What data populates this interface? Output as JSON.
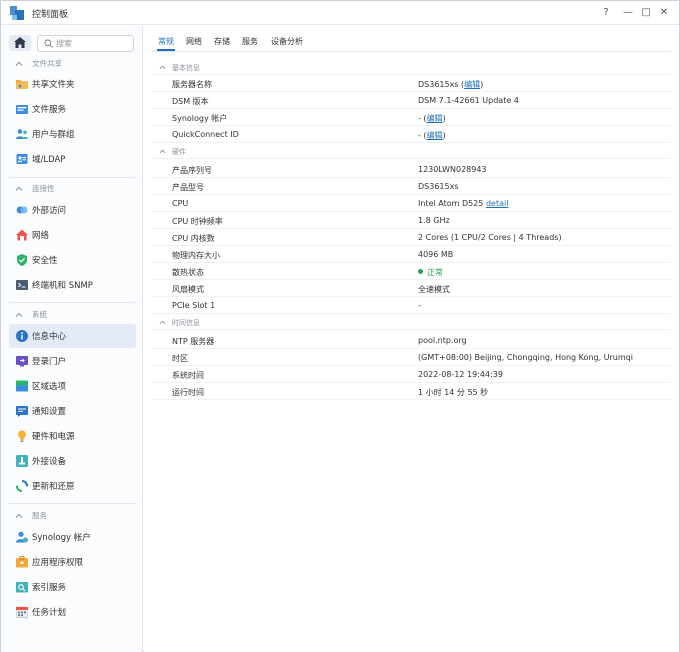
{
  "window": {
    "title": "控制面板",
    "help": "?",
    "minimize": "—",
    "maximize": "□",
    "close": "✕"
  },
  "sidebar": {
    "search_placeholder": "搜索",
    "sections": [
      {
        "title": "文件共享",
        "items": [
          {
            "label": "共享文件夹",
            "icon": "shared-folder-icon"
          },
          {
            "label": "文件服务",
            "icon": "file-services-icon"
          },
          {
            "label": "用户与群组",
            "icon": "users-groups-icon"
          },
          {
            "label": "域/LDAP",
            "icon": "domain-ldap-icon"
          }
        ]
      },
      {
        "title": "连接性",
        "items": [
          {
            "label": "外部访问",
            "icon": "external-access-icon"
          },
          {
            "label": "网络",
            "icon": "network-icon"
          },
          {
            "label": "安全性",
            "icon": "security-icon"
          },
          {
            "label": "终端机和 SNMP",
            "icon": "terminal-snmp-icon"
          }
        ]
      },
      {
        "title": "系统",
        "items": [
          {
            "label": "信息中心",
            "icon": "info-center-icon",
            "active": true
          },
          {
            "label": "登录门户",
            "icon": "login-portal-icon"
          },
          {
            "label": "区域选项",
            "icon": "regional-options-icon"
          },
          {
            "label": "通知设置",
            "icon": "notification-icon"
          },
          {
            "label": "硬件和电源",
            "icon": "hardware-power-icon"
          },
          {
            "label": "外接设备",
            "icon": "external-devices-icon"
          },
          {
            "label": "更新和还原",
            "icon": "update-restore-icon"
          }
        ]
      },
      {
        "title": "服务",
        "items": [
          {
            "label": "Synology 帐户",
            "icon": "synology-account-icon"
          },
          {
            "label": "应用程序权限",
            "icon": "app-privileges-icon"
          },
          {
            "label": "索引服务",
            "icon": "indexing-service-icon"
          },
          {
            "label": "任务计划",
            "icon": "task-scheduler-icon"
          }
        ]
      }
    ]
  },
  "tabs": [
    {
      "label": "常规",
      "active": true
    },
    {
      "label": "网络"
    },
    {
      "label": "存储"
    },
    {
      "label": "服务"
    },
    {
      "label": "设备分析"
    }
  ],
  "general": {
    "basic": {
      "title": "基本信息",
      "server_name_label": "服务器名称",
      "server_name_value": "DS3615xs",
      "dsm_label": "DSM 版本",
      "dsm_value": "DSM 7.1-42661 Update 4",
      "synology_label": "Synology 帐户",
      "synology_value": "-",
      "quickconnect_label": "QuickConnect ID",
      "quickconnect_value": "-",
      "edit": "编辑"
    },
    "hardware": {
      "title": "硬件",
      "serial_label": "产品序列号",
      "serial_value": "1230LWN028943",
      "model_label": "产品型号",
      "model_value": "DS3615xs",
      "cpu_label": "CPU",
      "cpu_value": "Intel Atom D525",
      "cpu_detail": "detail",
      "clock_label": "CPU 时钟频率",
      "clock_value": "1.8 GHz",
      "cores_label": "CPU 内核数",
      "cores_value": "2 Cores (1 CPU/2 Cores | 4 Threads)",
      "memory_label": "物理内存大小",
      "memory_value": "4096 MB",
      "thermal_label": "散热状态",
      "thermal_value": "正常",
      "fan_label": "风扇模式",
      "fan_value": "全速模式",
      "pcie_label": "PCIe Slot 1",
      "pcie_value": "-"
    },
    "time": {
      "title": "时间信息",
      "ntp_label": "NTP 服务器",
      "ntp_value": "pool.ntp.org",
      "tz_label": "时区",
      "tz_value": "(GMT+08:00) Beijing, Chongqing, Hong Kong, Urumqi",
      "systime_label": "系统时间",
      "systime_value": "2022-08-12 19:44:39",
      "uptime_label": "运行时间",
      "uptime_value": "1 小时 14 分 55 秒"
    }
  }
}
